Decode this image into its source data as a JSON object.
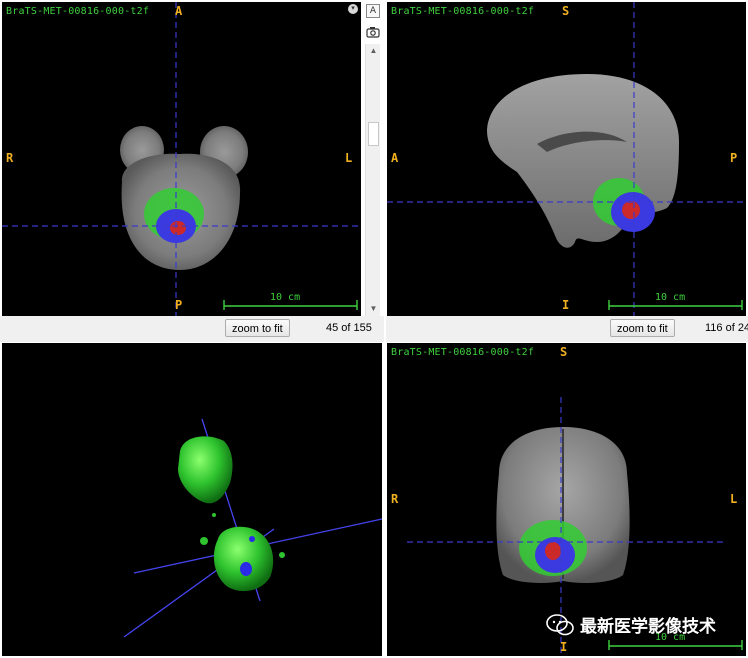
{
  "volume_name": "BraTS-MET-00816-000-t2f",
  "scale_text": "10 cm",
  "zoom_label": "zoom to fit",
  "panels": {
    "axial": {
      "title": "BraTS-MET-00816-000-t2f",
      "top": "A",
      "bottom": "P",
      "left": "R",
      "right": "L",
      "slice_text": "45 of 155"
    },
    "sagittal": {
      "title": "BraTS-MET-00816-000-t2f",
      "top": "S",
      "bottom": "I",
      "left": "A",
      "right": "P",
      "slice_text": "116 of 24"
    },
    "render3d": {},
    "coronal": {
      "title": "BraTS-MET-00816-000-t2f",
      "top": "S",
      "bottom": "I",
      "left": "R",
      "right": "L"
    }
  },
  "sidebar": {
    "collapse_icon": "chevron-down-circle-icon",
    "annotation_label": "A",
    "camera_icon": "camera-icon"
  },
  "watermark": {
    "text": "最新医学影像技术",
    "icon": "wechat-icon"
  },
  "colors": {
    "crosshair": "#3a3acc",
    "label_green": "#3fd13f",
    "orientation": "#f0b020",
    "edema": "#22dd22",
    "tumor_core": "#3333dd",
    "enhancing": "#dd2222"
  }
}
